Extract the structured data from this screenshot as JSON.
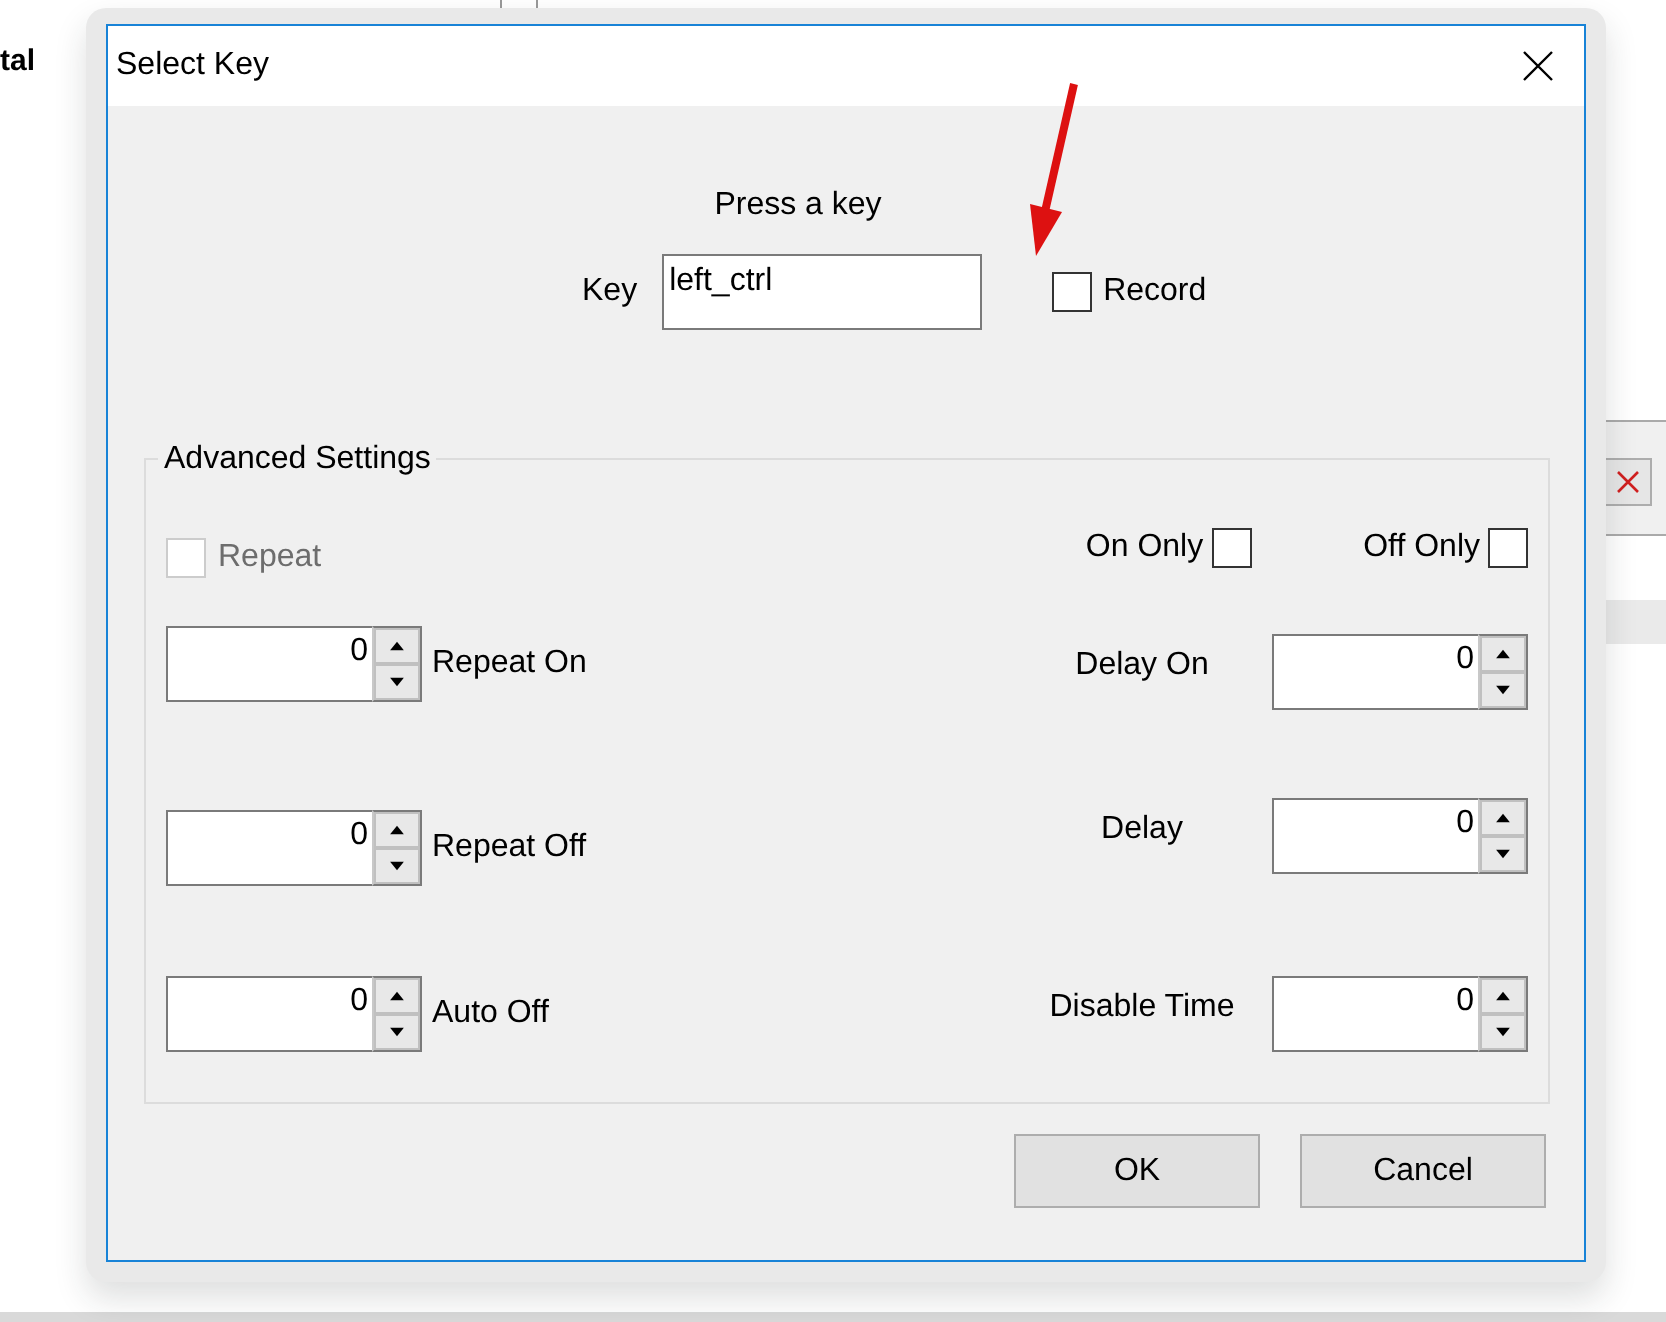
{
  "background": {
    "text": "tal"
  },
  "dialog": {
    "title": "Select Key",
    "prompt": "Press a key",
    "key": {
      "label": "Key",
      "value": "left_ctrl"
    },
    "record": {
      "label": "Record",
      "checked": false
    },
    "advanced": {
      "title": "Advanced Settings",
      "repeat": {
        "label": "Repeat",
        "checked": false,
        "disabled": true
      },
      "on_only": {
        "label": "On Only",
        "checked": false,
        "disabled": false
      },
      "off_only": {
        "label": "Off Only",
        "checked": false,
        "disabled": false
      },
      "left_spinners": [
        {
          "label": "Repeat On",
          "value": "0"
        },
        {
          "label": "Repeat Off",
          "value": "0"
        },
        {
          "label": "Auto Off",
          "value": "0"
        }
      ],
      "right_spinners": [
        {
          "label": "Delay On",
          "value": "0"
        },
        {
          "label": "Delay",
          "value": "0"
        },
        {
          "label": "Disable Time",
          "value": "0"
        }
      ]
    },
    "buttons": [
      "OK",
      "Cancel"
    ]
  }
}
